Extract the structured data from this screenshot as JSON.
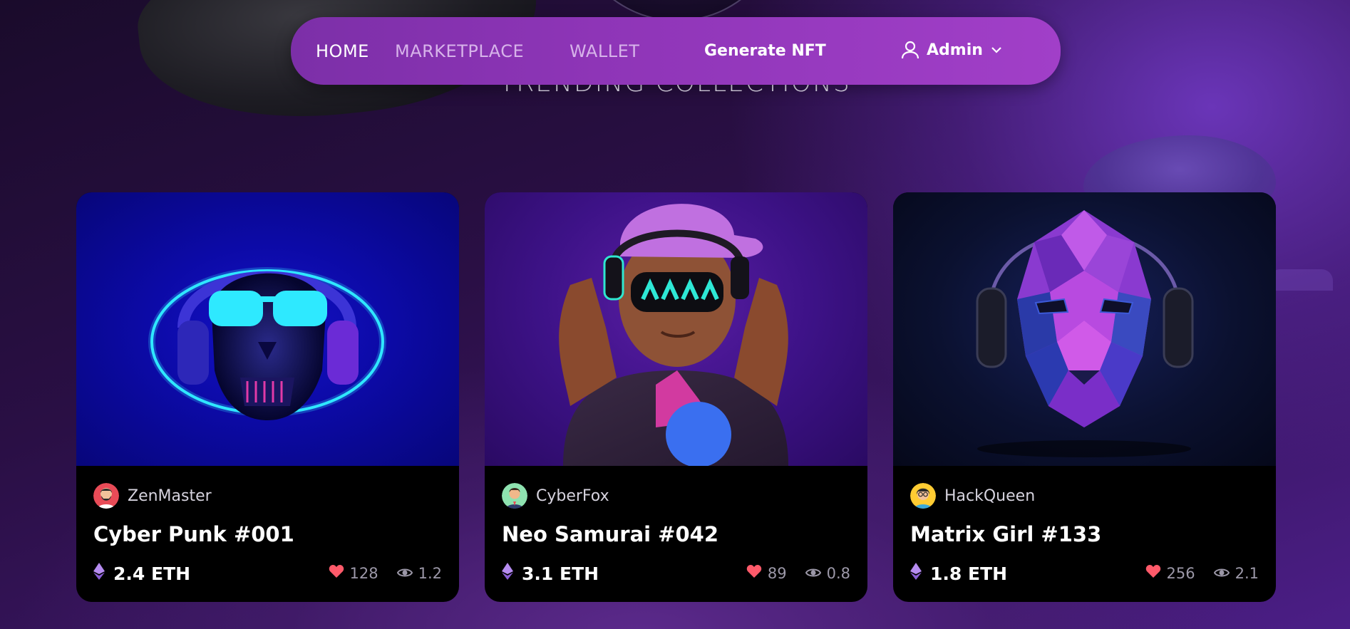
{
  "nav": {
    "links": [
      {
        "label": "HOME",
        "active": true
      },
      {
        "label": "MARKETPLACE",
        "active": false
      },
      {
        "label": "WALLET",
        "active": false
      }
    ],
    "generate_label": "Generate NFT",
    "user_label": "Admin",
    "user_icon": "user-icon",
    "dropdown_icon": "chevron-down-icon"
  },
  "section": {
    "title": "TRENDING COLLECTIONS"
  },
  "cards": [
    {
      "creator": "ZenMaster",
      "title": "Cyber Punk #001",
      "price": "2.4 ETH",
      "likes": "128",
      "views": "1.2",
      "art": "neon skull with sunglasses and headphones"
    },
    {
      "creator": "CyberFox",
      "title": "Neo Samurai #042",
      "price": "3.1 ETH",
      "likes": "89",
      "views": "0.8",
      "art": "3d character with cap, headphones and led glasses"
    },
    {
      "creator": "HackQueen",
      "title": "Matrix Girl #133",
      "price": "1.8 ETH",
      "likes": "256",
      "views": "2.1",
      "art": "low-poly purple face with headphones"
    }
  ],
  "colors": {
    "nav_bg": "#8e35b7",
    "card_bg": "#000000",
    "heart": "#ff5a6a",
    "eth": "#b68cf0"
  }
}
